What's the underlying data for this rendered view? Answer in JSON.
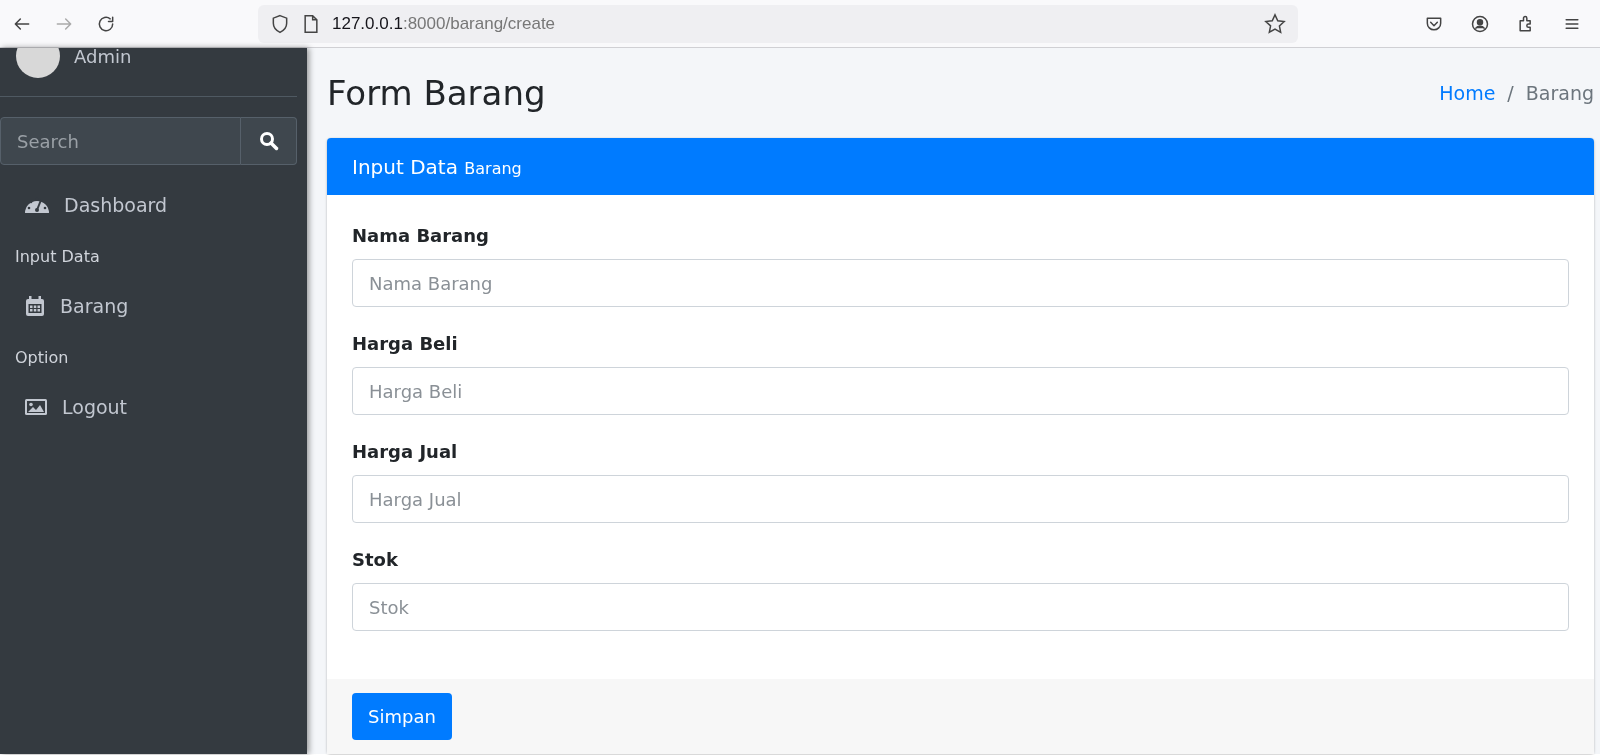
{
  "browser": {
    "url_host": "127.0.0.1",
    "url_path": ":8000/barang/create"
  },
  "sidebar": {
    "user": "Admin",
    "search": {
      "placeholder": "Search"
    },
    "items": [
      {
        "kind": "link",
        "label": "Dashboard"
      },
      {
        "kind": "header",
        "label": "Input Data"
      },
      {
        "kind": "link",
        "label": "Barang"
      },
      {
        "kind": "header",
        "label": "Option"
      },
      {
        "kind": "link",
        "label": "Logout"
      }
    ]
  },
  "page": {
    "title": "Form Barang",
    "breadcrumb_separator": "/",
    "breadcrumb": [
      {
        "label": "Home",
        "kind": "link"
      },
      {
        "label": "Barang",
        "kind": "current"
      }
    ]
  },
  "card": {
    "title": "Input Data",
    "subtitle": "Barang",
    "fields": [
      {
        "label": "Nama Barang",
        "placeholder": "Nama Barang"
      },
      {
        "label": "Harga Beli",
        "placeholder": "Harga Beli"
      },
      {
        "label": "Harga Jual",
        "placeholder": "Harga Jual"
      },
      {
        "label": "Stok",
        "placeholder": "Stok"
      }
    ],
    "submit": "Simpan"
  }
}
